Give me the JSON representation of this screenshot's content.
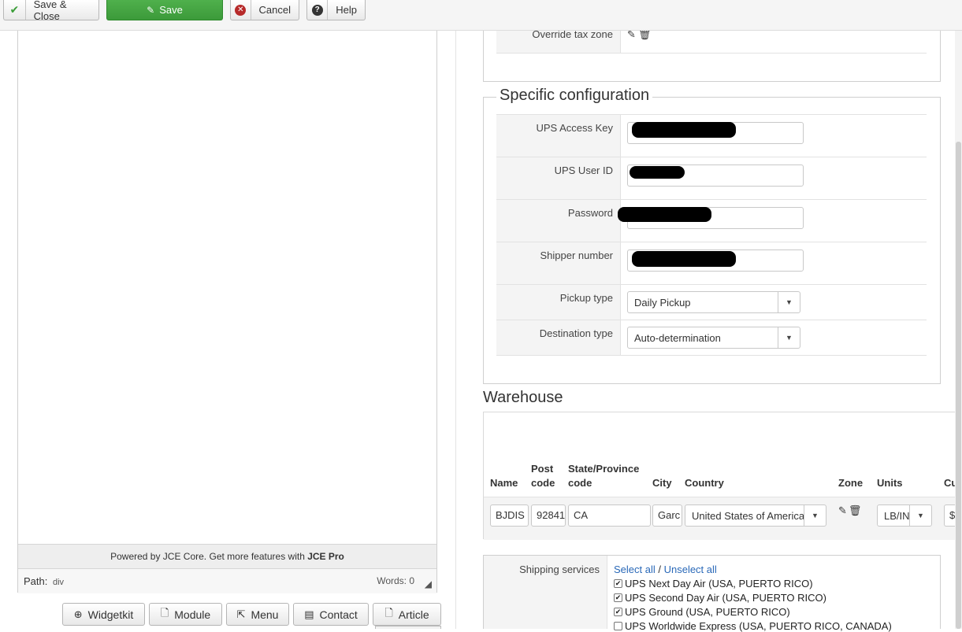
{
  "toolbar": {
    "save_close_label": "Save & Close",
    "save_label": "Save",
    "cancel_label": "Cancel",
    "help_label": "Help"
  },
  "editor": {
    "powered_text": "Powered by JCE Core. Get more features with ",
    "powered_link": "JCE Pro",
    "path_label": "Path:",
    "path_value": "div",
    "words_text": "Words: 0",
    "buttons": {
      "widgetkit": "Widgetkit",
      "module": "Module",
      "menu": "Menu",
      "contact": "Contact",
      "article": "Article"
    }
  },
  "tax": {
    "override_label": "Override tax zone"
  },
  "specific": {
    "legend": "Specific configuration",
    "access_key_label": "UPS Access Key",
    "user_id_label": "UPS User ID",
    "password_label": "Password",
    "shipper_label": "Shipper number",
    "pickup_label": "Pickup type",
    "pickup_value": "Daily Pickup",
    "destination_label": "Destination type",
    "destination_value": "Auto-determination"
  },
  "warehouse": {
    "title": "Warehouse",
    "columns": {
      "name": "Name",
      "post_code_1": "Post",
      "post_code_2": "code",
      "state_1": "State/Province",
      "state_2": "code",
      "city": "City",
      "country": "Country",
      "zone": "Zone",
      "units": "Units",
      "currency_partial": "Cu"
    },
    "row": {
      "name": "BJDIS",
      "post_code": "92841",
      "state": "CA",
      "city": "Garc",
      "country": "United States of America",
      "units": "LB/IN",
      "currency_partial": "$"
    }
  },
  "shipping": {
    "label": "Shipping services",
    "select_all": "Select all",
    "separator": " / ",
    "unselect_all": "Unselect all",
    "services": [
      {
        "label": "UPS Next Day Air (USA, PUERTO RICO)",
        "checked": true
      },
      {
        "label": "UPS Second Day Air (USA, PUERTO RICO)",
        "checked": true
      },
      {
        "label": "UPS Ground (USA, PUERTO RICO)",
        "checked": true
      },
      {
        "label": "UPS Worldwide Express (USA, PUERTO RICO, CANADA)",
        "checked": false
      }
    ]
  },
  "colors": {
    "save_green": "#3c9a3a",
    "link_blue": "#2a69b8",
    "cancel_red": "#b72a2a"
  }
}
